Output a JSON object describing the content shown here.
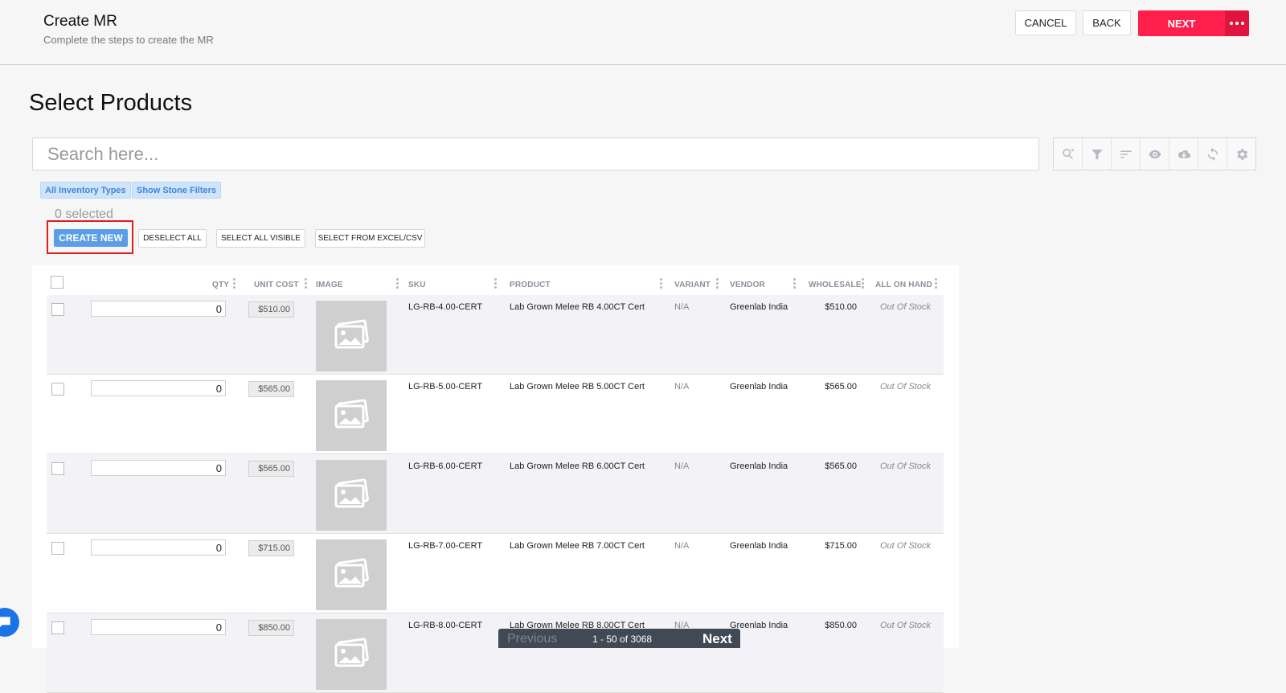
{
  "header": {
    "title": "Create MR",
    "subtitle": "Complete the steps to create the MR",
    "cancel_label": "CANCEL",
    "back_label": "BACK",
    "next_label": "NEXT"
  },
  "page_title": "Select Products",
  "search": {
    "placeholder": "Search here..."
  },
  "toolbar_icons": [
    "search-settings-icon",
    "filter-icon",
    "sort-icon",
    "eye-icon",
    "cloud-download-icon",
    "refresh-icon",
    "gear-icon"
  ],
  "filters": {
    "inventory_types": "All Inventory Types",
    "stone_filters": "Show Stone Filters"
  },
  "selection": {
    "count_text": "0 selected",
    "create_new": "CREATE NEW",
    "deselect_all": "DESELECT ALL",
    "select_all_visible": "SELECT ALL VISIBLE",
    "select_from_excel": "SELECT FROM EXCEL/CSV"
  },
  "table": {
    "columns": {
      "qty": "QTY",
      "unit_cost": "UNIT COST",
      "image": "IMAGE",
      "sku": "SKU",
      "product": "PRODUCT",
      "variant": "VARIANT",
      "vendor": "VENDOR",
      "wholesale": "WHOLESALE",
      "all_on_hand": "ALL ON HAND"
    },
    "rows": [
      {
        "qty": "0",
        "unit_cost": "$510.00",
        "sku": "LG-RB-4.00-CERT",
        "product": "Lab Grown Melee RB 4.00CT Cert",
        "variant": "N/A",
        "vendor": "Greenlab India",
        "wholesale": "$510.00",
        "on_hand": "Out Of Stock"
      },
      {
        "qty": "0",
        "unit_cost": "$565.00",
        "sku": "LG-RB-5.00-CERT",
        "product": "Lab Grown Melee RB 5.00CT Cert",
        "variant": "N/A",
        "vendor": "Greenlab India",
        "wholesale": "$565.00",
        "on_hand": "Out Of Stock"
      },
      {
        "qty": "0",
        "unit_cost": "$565.00",
        "sku": "LG-RB-6.00-CERT",
        "product": "Lab Grown Melee RB 6.00CT Cert",
        "variant": "N/A",
        "vendor": "Greenlab India",
        "wholesale": "$565.00",
        "on_hand": "Out Of Stock"
      },
      {
        "qty": "0",
        "unit_cost": "$715.00",
        "sku": "LG-RB-7.00-CERT",
        "product": "Lab Grown Melee RB 7.00CT Cert",
        "variant": "N/A",
        "vendor": "Greenlab India",
        "wholesale": "$715.00",
        "on_hand": "Out Of Stock"
      },
      {
        "qty": "0",
        "unit_cost": "$850.00",
        "sku": "LG-RB-8.00-CERT",
        "product": "Lab Grown Melee RB 8.00CT Cert",
        "variant": "N/A",
        "vendor": "Greenlab India",
        "wholesale": "$850.00",
        "on_hand": "Out Of Stock"
      }
    ]
  },
  "pagination": {
    "previous": "Previous",
    "range": "1 - 50 of 3068",
    "next": "Next"
  },
  "colors": {
    "primary_next": "#ff1f4d",
    "create_new": "#5b9de6",
    "highlight_outline": "#e21b1b"
  }
}
